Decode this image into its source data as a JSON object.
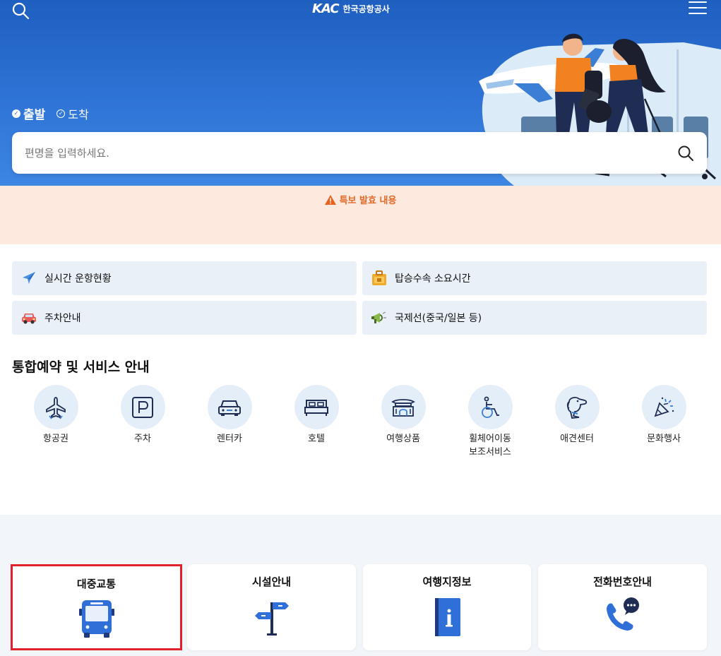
{
  "header": {
    "logo_mark": "KAC",
    "logo_text": "한국공항공사"
  },
  "flight_type": {
    "departure": "출발",
    "arrival": "도착",
    "selected": "departure"
  },
  "search": {
    "placeholder": "편명을 입력하세요."
  },
  "alert": {
    "text": "특보 발효 내용"
  },
  "quick_links": [
    {
      "label": "실시간 운항현황",
      "icon": "airplane-icon"
    },
    {
      "label": "탑승수속 소요시간",
      "icon": "suitcase-icon"
    },
    {
      "label": "주차안내",
      "icon": "car-icon"
    },
    {
      "label": "국제선(중국/일본 등)",
      "icon": "megaphone-icon"
    }
  ],
  "services": {
    "title": "통합예약 및 서비스 안내",
    "items": [
      {
        "label": "항공권",
        "icon": "airplane-ticket-icon"
      },
      {
        "label": "주차",
        "icon": "parking-icon"
      },
      {
        "label": "렌터카",
        "icon": "rental-car-icon"
      },
      {
        "label": "호텔",
        "icon": "bed-icon"
      },
      {
        "label": "여행상품",
        "icon": "palace-icon"
      },
      {
        "label": "휠체어이동\n보조서비스",
        "icon": "wheelchair-icon"
      },
      {
        "label": "애견센터",
        "icon": "dog-icon"
      },
      {
        "label": "문화행사",
        "icon": "party-popper-icon"
      }
    ]
  },
  "info_cards": [
    {
      "label": "대중교통",
      "icon": "bus-icon",
      "selected": true
    },
    {
      "label": "시설안내",
      "icon": "signpost-icon",
      "selected": false
    },
    {
      "label": "여행지정보",
      "icon": "info-book-icon",
      "selected": false
    },
    {
      "label": "전화번호안내",
      "icon": "phone-chat-icon",
      "selected": false
    }
  ],
  "colors": {
    "hero_blue": "#1e5fc0",
    "alert_bg": "#fde9de",
    "alert_text": "#e06a2a",
    "quick_bg": "#e9f0f8",
    "icon_circle": "#e4eef9",
    "selected_border": "#e0202a",
    "bus_blue": "#2f6fd8"
  }
}
